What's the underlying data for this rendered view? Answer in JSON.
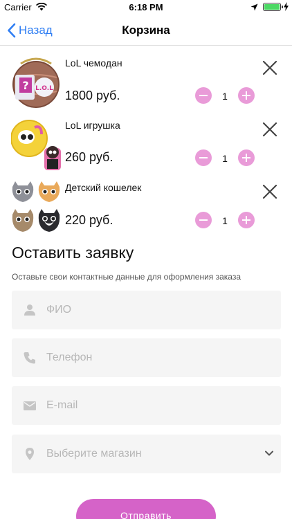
{
  "status_bar": {
    "carrier": "Carrier",
    "time": "6:18 PM",
    "battery_level": 1.0
  },
  "nav": {
    "back_label": "Назад",
    "title": "Корзина"
  },
  "cart": {
    "items": [
      {
        "name": "LoL чемодан",
        "price": "1800 руб.",
        "quantity": "1",
        "image": "lol-surprise-ball-image"
      },
      {
        "name": "LoL  игрушка",
        "price": "260 руб.",
        "quantity": "1",
        "image": "lol-doll-toy-image"
      },
      {
        "name": "Детский кошелек",
        "price": "220 руб.",
        "quantity": "1",
        "image": "cat-wallets-image"
      }
    ]
  },
  "form": {
    "title": "Оставить заявку",
    "subtitle": "Оставьте свои контактные данные для оформления заказа",
    "name_placeholder": "ФИО",
    "phone_placeholder": "Телефон",
    "email_placeholder": "E-mail",
    "store_placeholder": "Выберите магазин",
    "submit_label": "Отправить"
  },
  "colors": {
    "accent": "#2f7ef3",
    "qty_button": "#e99bd8",
    "submit": "#d563c8",
    "field_bg": "#f5f5f5"
  }
}
